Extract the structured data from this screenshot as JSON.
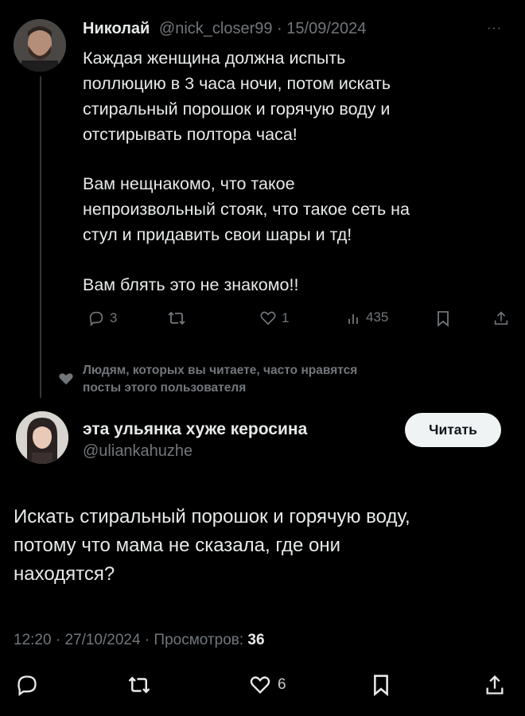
{
  "reply_tweet": {
    "author_name": "Николай",
    "handle": "@nick_closer99",
    "sep": "·",
    "date": "15/09/2024",
    "more": "···",
    "text_p1": "Каждая женщина должна испыть\nполлюцию в 3 часа ночи, потом искать\nстиральный порошок и горячую воду и\nотстирывать полтора часа!",
    "text_p2": "Вам нещнакомо, что такое\nнепроизвольный стояк, что такое сеть на\nстул и придавить свои шары и тд!",
    "text_p3": "Вам блять это не знакомо!!",
    "replies": "3",
    "likes": "1",
    "views": "435"
  },
  "social_context": {
    "text": "Людям, которых вы читаете, часто нравятся\nпосты этого пользователя"
  },
  "main_tweet": {
    "author_name": "эта ульянка хуже керосина",
    "handle": "@uliankahuzhe",
    "follow_label": "Читать",
    "text": "Искать стиральный порошок и горячую воду,\nпотому что мама не сказала, где они\nнаходятся?",
    "time": "12:20",
    "sep1": "·",
    "date": "27/10/2024",
    "sep2": "·",
    "views_label": "Просмотров:",
    "views": "36",
    "likes": "6"
  },
  "colors": {
    "background": "#000000",
    "text": "#e7e9ea",
    "muted": "#71767b",
    "button_bg": "#eff3f4"
  }
}
